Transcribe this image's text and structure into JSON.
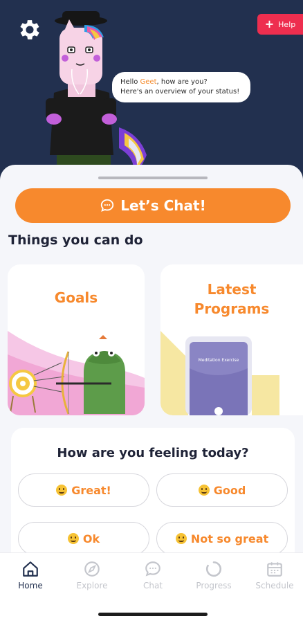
{
  "header": {
    "help_label": "Help",
    "greeting_prefix": "Hello ",
    "user_name": "Geet",
    "greeting_suffix": ", how are you?",
    "greeting_line2": "Here's an overview of your status!"
  },
  "chat_button": {
    "label": "Let’s Chat!"
  },
  "things": {
    "title": "Things you can do",
    "goals": {
      "title": "Goals"
    },
    "programs": {
      "title_line1": "Latest",
      "title_line2": "Programs",
      "screen_label": "Meditation Exercise"
    }
  },
  "mood": {
    "question": "How are you feeling today?",
    "options": [
      "Great!",
      "Good",
      "Ok",
      "Not so great"
    ]
  },
  "tabs": [
    {
      "label": "Home",
      "icon": "home-icon",
      "active": true
    },
    {
      "label": "Explore",
      "icon": "compass-icon",
      "active": false
    },
    {
      "label": "Chat",
      "icon": "chat-bubble-icon",
      "active": false
    },
    {
      "label": "Progress",
      "icon": "progress-ring-icon",
      "active": false
    },
    {
      "label": "Schedule",
      "icon": "calendar-icon",
      "active": false
    }
  ],
  "colors": {
    "header_bg": "#22304f",
    "accent_orange": "#f7892d",
    "help_red": "#ee2e4f",
    "active_tab": "#22304f",
    "inactive_tab": "#c4c6cc"
  }
}
